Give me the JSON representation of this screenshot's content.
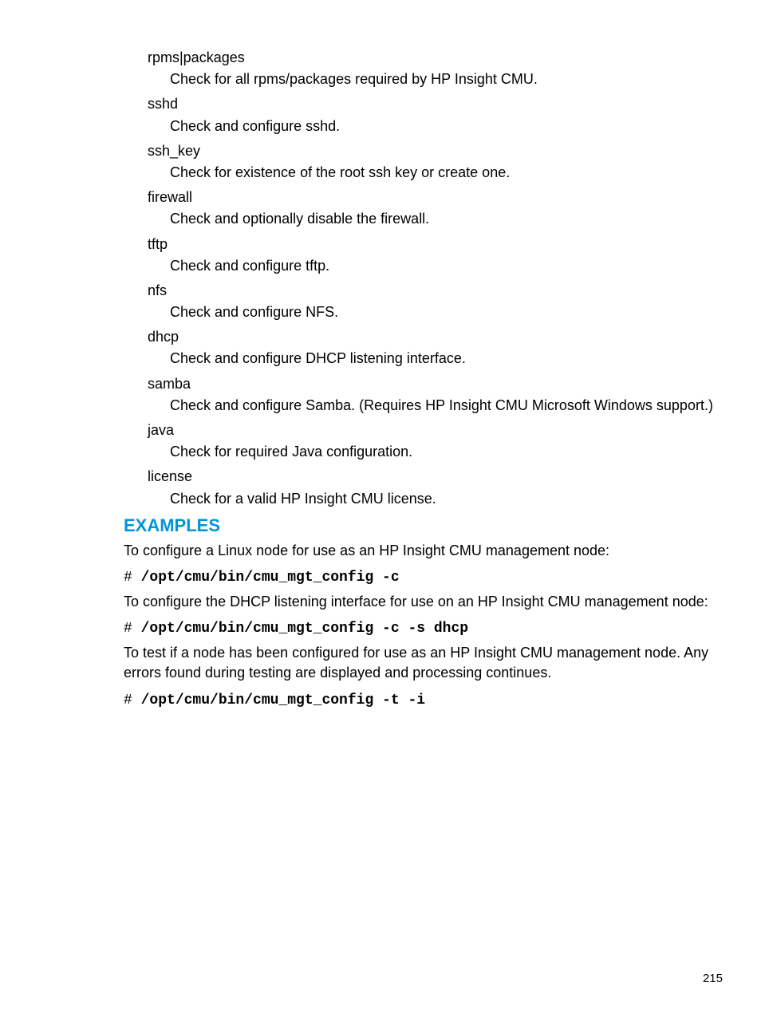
{
  "defs": [
    {
      "term": "rpms|packages",
      "desc": "Check for all rpms/packages required by HP Insight CMU."
    },
    {
      "term": "sshd",
      "desc": "Check and configure sshd."
    },
    {
      "term": "ssh_key",
      "desc": "Check for existence of the root ssh key or create one."
    },
    {
      "term": "firewall",
      "desc": "Check and optionally disable the firewall."
    },
    {
      "term": "tftp",
      "desc": "Check and configure tftp."
    },
    {
      "term": "nfs",
      "desc": "Check and configure NFS."
    },
    {
      "term": "dhcp",
      "desc": "Check and configure DHCP listening interface."
    },
    {
      "term": "samba",
      "desc": "Check and configure Samba. (Requires HP Insight CMU Microsoft Windows support.)"
    },
    {
      "term": "java",
      "desc": "Check for required Java configuration."
    },
    {
      "term": "license",
      "desc": "Check for a valid HP Insight CMU license."
    }
  ],
  "examples_heading": "EXAMPLES",
  "example1_text": "To configure a Linux node for use as an HP Insight CMU management node:",
  "example1_prompt": "# ",
  "example1_cmd": "/opt/cmu/bin/cmu_mgt_config -c",
  "example2_text": "To configure the DHCP listening interface for use on an HP Insight CMU management node:",
  "example2_prompt": "# ",
  "example2_cmd": "/opt/cmu/bin/cmu_mgt_config -c -s dhcp",
  "example3_text": "To test if a node has been configured for use as an HP Insight CMU management node. Any errors found during testing are displayed and processing continues.",
  "example3_prompt": "# ",
  "example3_cmd": "/opt/cmu/bin/cmu_mgt_config -t -i",
  "page_number": "215"
}
